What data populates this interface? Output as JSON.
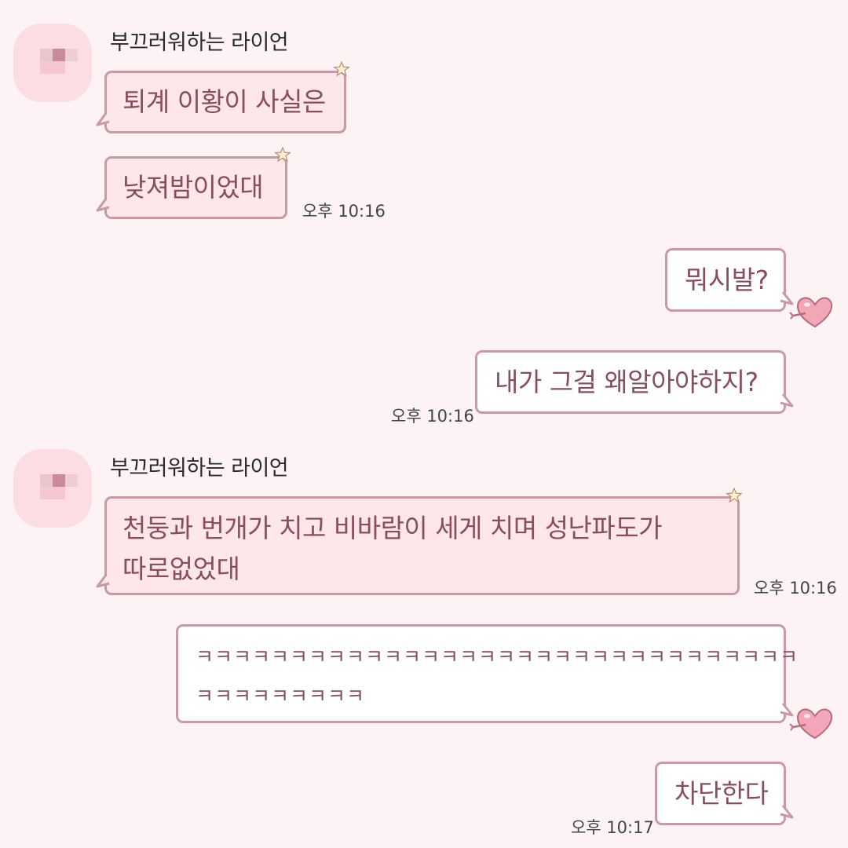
{
  "theme": {
    "background": "#fdf3f5",
    "bubble_border": "#c99aa5",
    "bubble_in": "#fde7ea",
    "bubble_out": "#ffffff",
    "text": "#8a4c5f",
    "heart": "#f4a6b9"
  },
  "chat": {
    "sender_name": "부끄러워하는 라이언",
    "messages": [
      {
        "dir": "in",
        "text": "퇴계 이황이 사실은"
      },
      {
        "dir": "in",
        "text": "낮져밤이었대",
        "time": "오후 10:16"
      },
      {
        "dir": "out",
        "text": "뭐시발?"
      },
      {
        "dir": "out",
        "text": "내가 그걸 왜알아야하지?",
        "time": "오후 10:16"
      },
      {
        "dir": "in",
        "text": "천둥과 번개가 치고 비바람이 세게 치며 성난파도가\n따로없었대",
        "time": "오후 10:16"
      },
      {
        "dir": "out",
        "text": "ㅋㅋㅋㅋㅋㅋㅋㅋㅋㅋㅋㅋㅋㅋㅋㅋㅋㅋㅋㅋㅋㅋㅋㅋㅋㅋㅋㅋㅋㅋㅋㅋ\nㅋㅋㅋㅋㅋㅋㅋㅋㅋ"
      },
      {
        "dir": "out",
        "text": "차단한다",
        "time": "오후 10:17"
      }
    ]
  }
}
